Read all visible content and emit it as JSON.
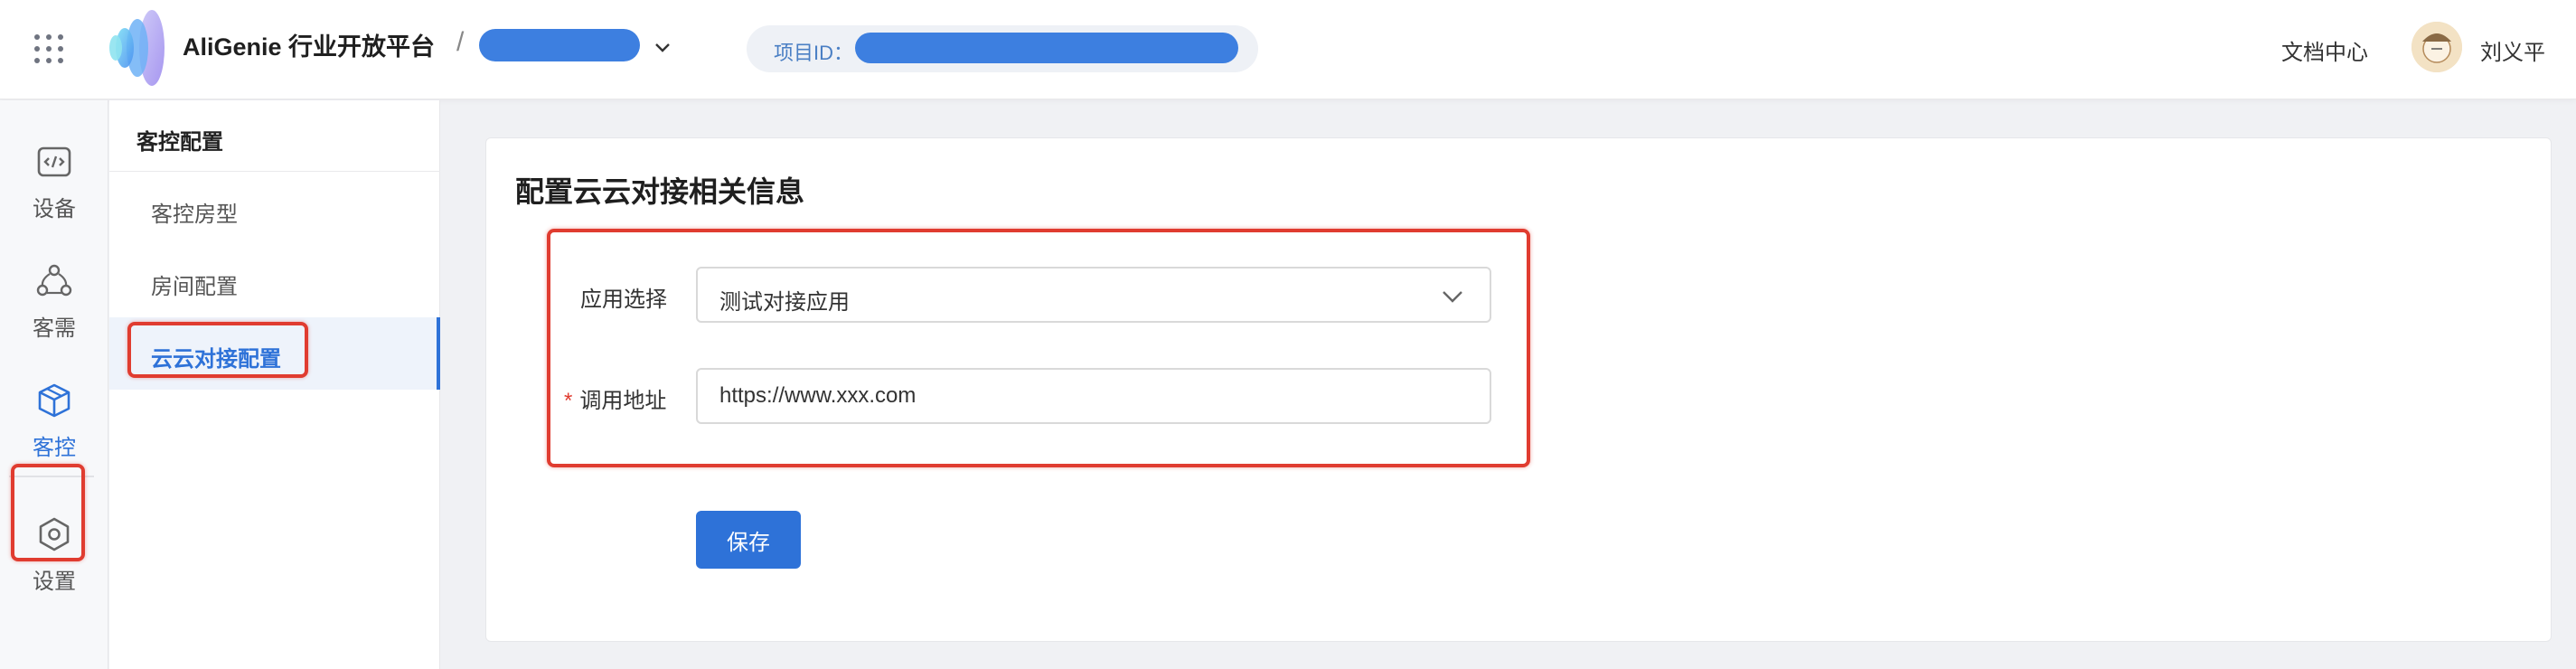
{
  "header": {
    "brand": "AliGenie 行业开放平台",
    "separator": "/",
    "project_id_label": "项目ID：",
    "doc_center": "文档中心",
    "username": "刘义平"
  },
  "rail": {
    "items": [
      {
        "label": "设备",
        "icon": "code-window-icon"
      },
      {
        "label": "客需",
        "icon": "nodes-icon"
      },
      {
        "label": "客控",
        "icon": "cube-icon",
        "active": true
      },
      {
        "label": "设置",
        "icon": "hexagon-settings-icon"
      }
    ]
  },
  "submenu": {
    "title": "客控配置",
    "items": [
      {
        "label": "客控房型"
      },
      {
        "label": "房间配置"
      },
      {
        "label": "云云对接配置",
        "active": true
      }
    ]
  },
  "main": {
    "title": "配置云云对接相关信息",
    "app_select": {
      "label": "应用选择",
      "value": "测试对接应用"
    },
    "call_url": {
      "label": "调用地址",
      "required_mark": "*",
      "value": "https://www.xxx.com"
    },
    "save_label": "保存"
  },
  "colors": {
    "accent": "#2e72d8",
    "highlight_box": "#e03c30",
    "redaction": "#3d7fe0"
  }
}
